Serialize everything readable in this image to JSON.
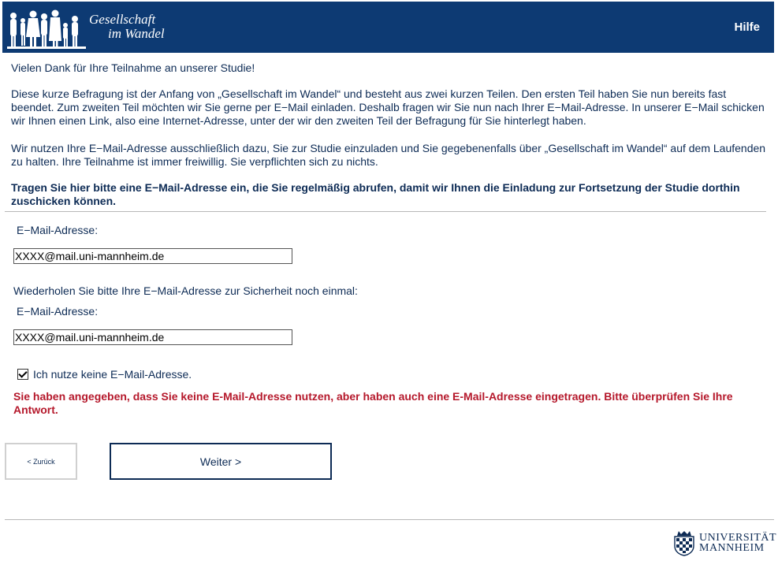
{
  "header": {
    "logo_line1": "Gesellschaft",
    "logo_line2": "im Wandel",
    "help_label": "Hilfe"
  },
  "content": {
    "intro": "Vielen Dank für Ihre Teilnahme an unserer Studie!",
    "para1": "Diese kurze Befragung ist der Anfang von „Gesellschaft im Wandel“ und besteht aus zwei kurzen Teilen. Den ersten Teil haben Sie nun bereits fast beendet. Zum zweiten Teil möchten wir Sie gerne per E−Mail einladen. Deshalb fragen wir Sie nun nach Ihrer E−Mail-Adresse. In unserer E−Mail schicken wir Ihnen einen Link, also eine Internet-Adresse, unter der wir den zweiten Teil der Befragung für Sie hinterlegt haben.",
    "para2": "Wir nutzen Ihre E−Mail-Adresse ausschließlich dazu, Sie zur Studie einzuladen und Sie gegebenenfalls über „Gesellschaft im Wandel“ auf dem Laufenden zu halten. Ihre Teilnahme ist immer freiwillig. Sie verpflichten sich zu nichts.",
    "question": "Tragen Sie hier bitte eine E−Mail-Adresse ein, die Sie regelmäßig abrufen, damit wir Ihnen die Einladung zur Fortsetzung der Studie dorthin zuschicken können."
  },
  "form": {
    "email_label": "E−Mail-Adresse:",
    "email_value": "XXXX@mail.uni-mannheim.de",
    "repeat_prompt": "Wiederholen Sie bitte Ihre E−Mail-Adresse zur Sicherheit noch einmal:",
    "email_label2": "E−Mail-Adresse:",
    "email_value2": "XXXX@mail.uni-mannheim.de",
    "no_email_label": "Ich nutze keine E−Mail-Adresse.",
    "no_email_checked": true,
    "error": "Sie haben angegeben, dass Sie keine E-Mail-Adresse nutzen, aber haben auch eine E-Mail-Adresse eingetragen. Bitte überprüfen Sie Ihre Antwort."
  },
  "nav": {
    "back_label": "< Zurück",
    "next_label": "Weiter >"
  },
  "footer": {
    "uni_line1": "UNIVERSITÄT",
    "uni_line2": "MANNHEIM"
  },
  "colors": {
    "header_bg": "#0d3a73",
    "text": "#0d2b55",
    "error": "#b5182b"
  }
}
